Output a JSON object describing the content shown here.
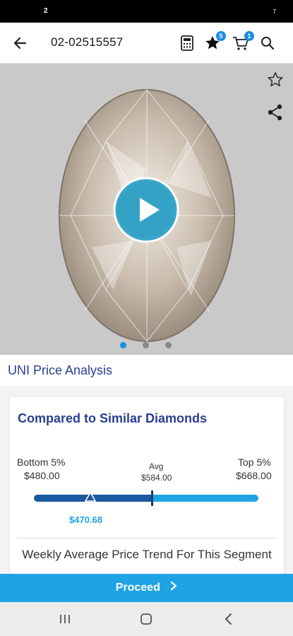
{
  "status_bar": {
    "left_text": "2",
    "right_text": "7"
  },
  "header": {
    "title": "02-02515557",
    "favorites_badge": "5",
    "cart_badge": "1",
    "icons": [
      "back-arrow-icon",
      "calculator-icon",
      "star-icon",
      "cart-icon",
      "search-icon"
    ]
  },
  "media": {
    "icons": [
      "play-icon",
      "star-outline-icon",
      "share-icon"
    ],
    "carousel_dots": 3,
    "active_dot": 0
  },
  "price_analysis": {
    "section_title": "UNI Price Analysis",
    "card_title": "Compared to Similar Diamonds",
    "bottom_label": "Bottom 5%",
    "bottom_value": "$480.00",
    "avg_label": "Avg",
    "avg_value": "$584.00",
    "top_label": "Top 5%",
    "top_value": "$668.00",
    "current_value": "$470.68",
    "trend_title": "Weekly Average Price Trend For This Segment"
  },
  "footer": {
    "proceed_label": "Proceed"
  },
  "colors": {
    "brand_blue": "#2a3f91",
    "accent_blue": "#1fa3e4",
    "dark_bar": "#1b5aa0"
  }
}
